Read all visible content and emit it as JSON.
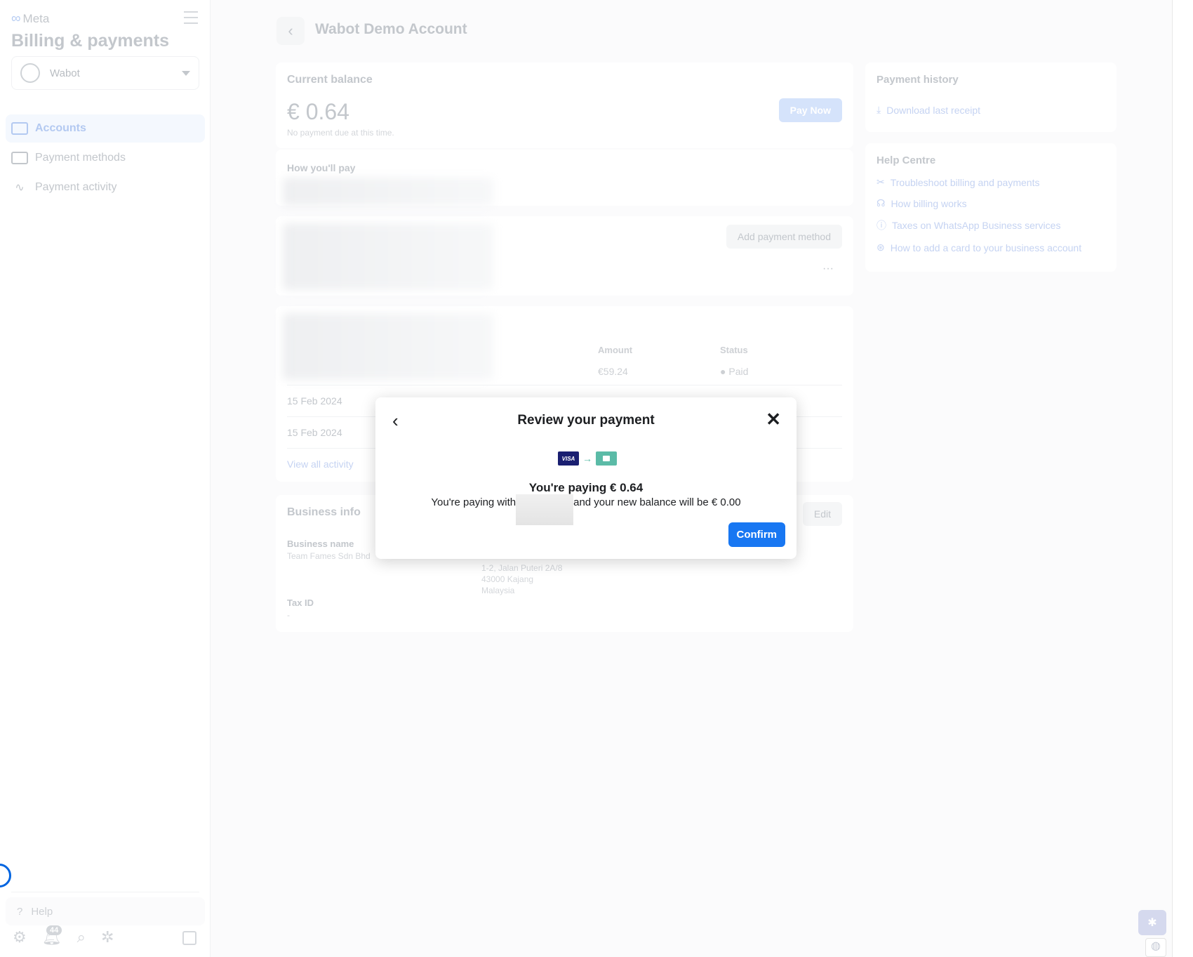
{
  "sidebar": {
    "brand": "Meta",
    "title": "Billing & payments",
    "account": "Wabot",
    "items": [
      {
        "label": "Accounts",
        "icon": "accounts-icon",
        "active": true
      },
      {
        "label": "Payment methods",
        "icon": "credit-card-icon"
      },
      {
        "label": "Payment activity",
        "icon": "activity-icon"
      }
    ],
    "help": "Help",
    "notification_count": "44"
  },
  "header": {
    "title": "Wabot Demo Account"
  },
  "balance": {
    "heading": "Current balance",
    "amount": "€ 0.64",
    "note": "No payment due at this time.",
    "pay_now": "Pay Now"
  },
  "how_pay": {
    "heading": "How you'll pay",
    "add_method": "Add payment method",
    "more": "···"
  },
  "activity": {
    "columns": [
      "Amount",
      "Status"
    ],
    "amount": "€59.24",
    "status": "Paid",
    "dates": [
      "15 Feb 2024",
      "15 Feb 2024"
    ],
    "view_all": "View all activity"
  },
  "business": {
    "heading": "Business info",
    "edit": "Edit",
    "name_label": "Business name",
    "name": "Team Fames Sdn Bhd",
    "address": [
      "1-2, Jalan Puteri 2A/8",
      "43000 Kajang",
      "Malaysia"
    ],
    "tax_label": "Tax ID",
    "tax": "-"
  },
  "payment_history": {
    "heading": "Payment history",
    "download": "Download last receipt"
  },
  "help_centre": {
    "heading": "Help Centre",
    "links": [
      "Troubleshoot billing and payments",
      "How billing works",
      "Taxes on WhatsApp Business services",
      "How to add a card to your business account"
    ]
  },
  "modal": {
    "title": "Review your payment",
    "card_brand": "VISA",
    "amount_line": "You're paying € 0.64",
    "text_before": "You're paying with",
    "text_after": "and your new balance will be € 0.00",
    "confirm": "Confirm"
  },
  "colors": {
    "accent": "#1877f2",
    "visa": "#1a1f71",
    "wallet": "#5bbba7"
  }
}
